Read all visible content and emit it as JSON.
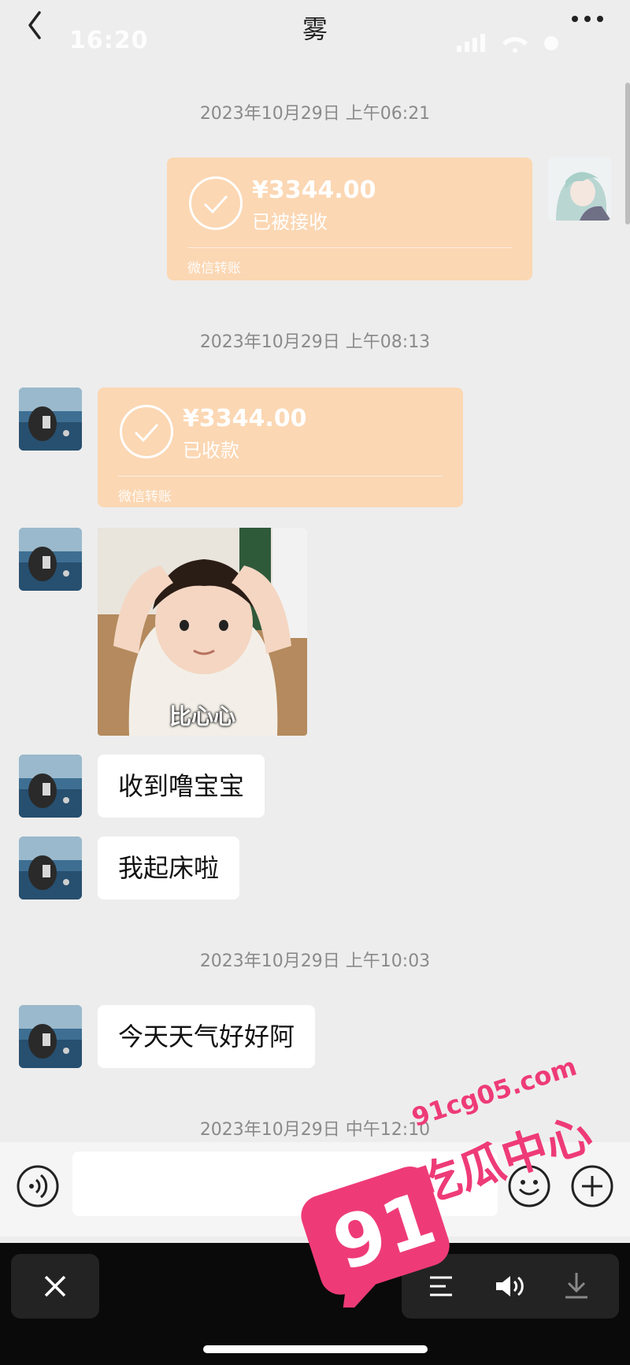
{
  "header": {
    "title": "雾",
    "status_time": "16:20"
  },
  "messages": {
    "ts1": "2023年10月29日 上午06:21",
    "ts2": "2023年10月29日 上午08:13",
    "ts3": "2023年10月29日 上午10:03",
    "ts4": "2023年10月29日 中午12:10",
    "transfer1": {
      "amount": "¥3344.00",
      "status": "已被接收",
      "footer": "微信转账"
    },
    "transfer2": {
      "amount": "¥3344.00",
      "status": "已收款",
      "footer": "微信转账"
    },
    "sticker_caption": "比心心",
    "text1": "收到噜宝宝",
    "text2": "我起床啦",
    "text3": "今天天气好好阿"
  },
  "watermark": {
    "number": "91",
    "domain": "91cg05.com",
    "name": "吃瓜中心"
  },
  "colors": {
    "transfer_bg": "#fbd7b3",
    "watermark": "#ee3b78"
  }
}
